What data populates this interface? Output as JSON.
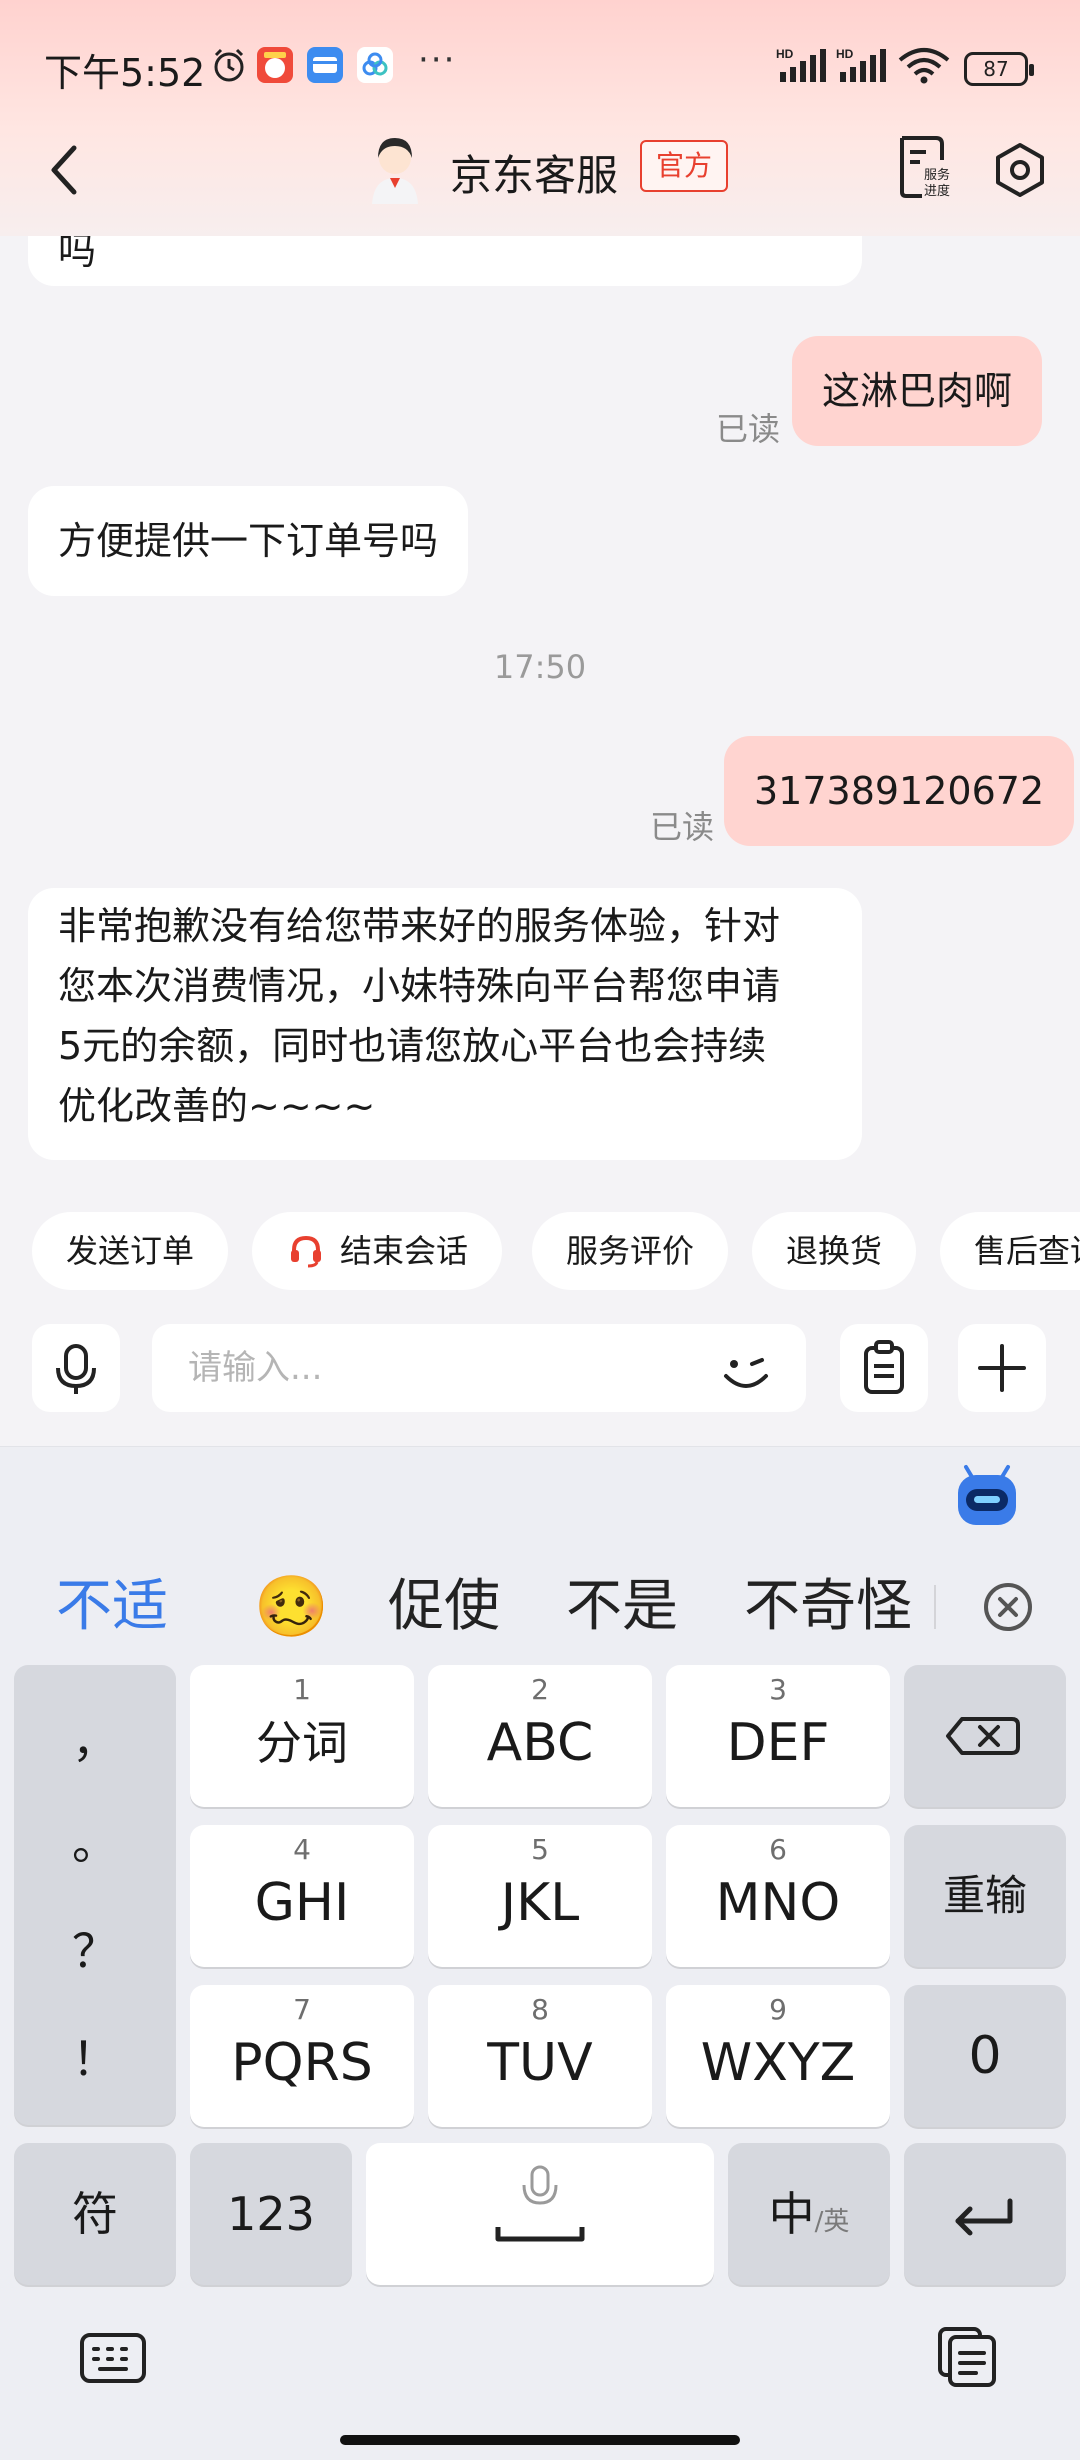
{
  "status_bar": {
    "time": "下午5:52",
    "network_1": "HD",
    "network_2": "HD",
    "battery": "87"
  },
  "nav": {
    "title": "京东客服",
    "badge": "官方",
    "service_progress": "服务进度"
  },
  "chat": {
    "messages": [
      {
        "side": "left",
        "text": "吗"
      },
      {
        "side": "right",
        "text": "这淋巴肉啊",
        "status": "已读"
      },
      {
        "side": "left",
        "text": "方便提供一下订单号吗"
      },
      {
        "time": "17:50"
      },
      {
        "side": "right",
        "text": "317389120672",
        "status": "已读"
      },
      {
        "side": "left",
        "lines": [
          "非常抱歉没有给您带来好的服务体验，针对",
          "您本次消费情况，小妹特殊向平台帮您申请",
          "5元的余额，同时也请您放心平台也会持续",
          "优化改善的~~~~"
        ]
      }
    ]
  },
  "quick_replies": [
    "发送订单",
    "结束会话",
    "服务评价",
    "退换货",
    "售后查询"
  ],
  "input": {
    "placeholder": "请输入..."
  },
  "keyboard": {
    "candidates": [
      "不适",
      "🥴",
      "促使",
      "不是",
      "不奇怪"
    ],
    "punctuation": [
      "，",
      "。",
      "？",
      "！"
    ],
    "keys": {
      "k1": {
        "num": "1",
        "label": "分词"
      },
      "k2": {
        "num": "2",
        "label": "ABC"
      },
      "k3": {
        "num": "3",
        "label": "DEF"
      },
      "k4": {
        "num": "4",
        "label": "GHI"
      },
      "k5": {
        "num": "5",
        "label": "JKL"
      },
      "k6": {
        "num": "6",
        "label": "MNO"
      },
      "k7": {
        "num": "7",
        "label": "PQRS"
      },
      "k8": {
        "num": "8",
        "label": "TUV"
      },
      "k9": {
        "num": "9",
        "label": "WXYZ"
      },
      "reenter": "重输",
      "zero": "0",
      "symbols": "符",
      "numbers": "123",
      "lang_main": "中",
      "lang_alt": "/英"
    }
  },
  "colors": {
    "accent_red": "#e8402f",
    "bubble_mine": "#ffd4d0",
    "candidate_blue": "#3a7be8"
  }
}
